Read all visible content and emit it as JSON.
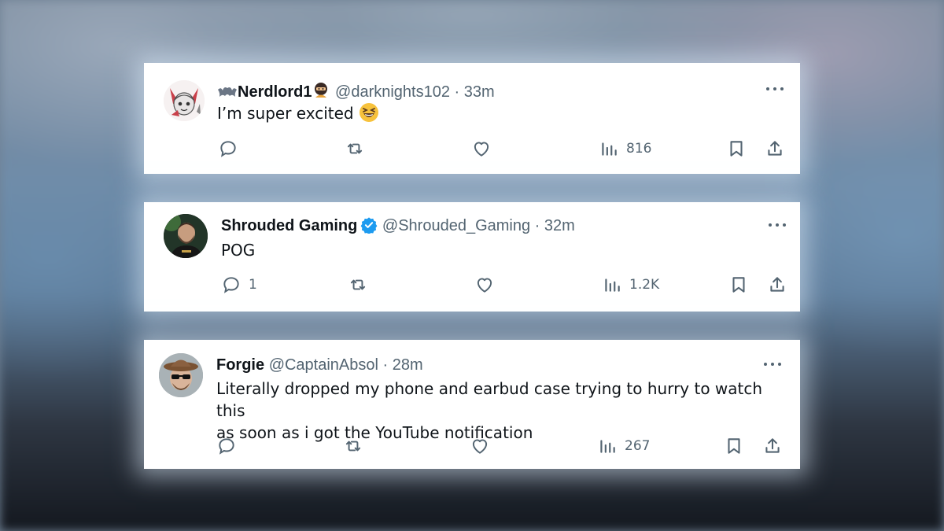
{
  "tweets": [
    {
      "display_name": "Nerdlord1",
      "handle": "@darknights102",
      "separator": "·",
      "time": "33m",
      "text": "I’m super excited",
      "reply_count": "",
      "views": "816",
      "avatar_icon": "anime-character-avatar",
      "name_prefix_icon": "bat-emoji",
      "name_suffix_icon": "ninja-emoji",
      "text_emoji": "grinning-squinting-face-emoji"
    },
    {
      "display_name": "Shrouded Gaming",
      "handle": "@Shrouded_Gaming",
      "separator": "·",
      "time": "32m",
      "text": "POG",
      "reply_count": "1",
      "views": "1.2K",
      "avatar_icon": "bearded-man-avatar",
      "verified": true
    },
    {
      "display_name": "Forgie",
      "handle": "@CaptainAbsol",
      "separator": "·",
      "time": "28m",
      "text_line1": "Literally dropped my phone and earbud case trying to hurry to watch this",
      "text_line2": "as soon as i got the YouTube notification",
      "reply_count": "",
      "views": "267",
      "avatar_icon": "hat-sunglasses-avatar"
    }
  ],
  "colors": {
    "text_primary": "#0f1419",
    "text_secondary": "#536471",
    "verified_blue": "#1d9bf0",
    "card_bg": "#ffffff"
  }
}
